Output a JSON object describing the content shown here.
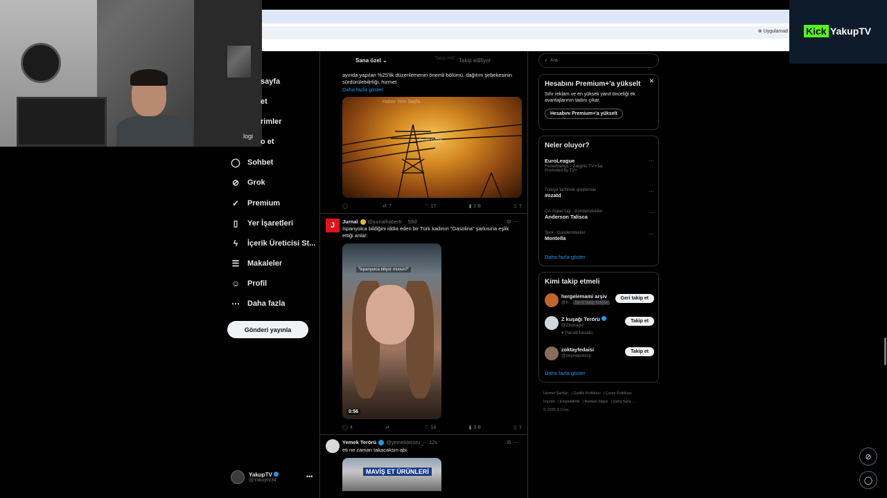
{
  "brand": {
    "kick": "Kick",
    "name": "YakupTV"
  },
  "browser": {
    "apps_label": "Uygulamad"
  },
  "webcam_overlay": {
    "word": "logi"
  },
  "nav": {
    "items": [
      {
        "label": "sayfa",
        "icon": "home-icon"
      },
      {
        "label": "et",
        "icon": "explore-icon"
      },
      {
        "label": "rimler",
        "icon": "notifications-icon"
      },
      {
        "label": "o et",
        "icon": "follow-icon"
      },
      {
        "label": "Sohbet",
        "icon": "chat-icon"
      },
      {
        "label": "Grok",
        "icon": "grok-icon"
      },
      {
        "label": "Premium",
        "icon": "premium-icon"
      },
      {
        "label": "Yer İşaretleri",
        "icon": "bookmark-icon"
      },
      {
        "label": "İçerik Üreticisi St...",
        "icon": "lightning-icon"
      },
      {
        "label": "Makaleler",
        "icon": "articles-icon"
      },
      {
        "label": "Profil",
        "icon": "profile-icon"
      },
      {
        "label": "Daha fazla",
        "icon": "more-icon"
      }
    ],
    "post_button": "Gönderi yayınla",
    "profile": {
      "name": "YakupTV",
      "handle": "@Yakuptv34"
    }
  },
  "tabs": {
    "active": "Sana özel",
    "ghost": "Takip edil",
    "other": "Takip ediliyor"
  },
  "tweet1": {
    "text_l1": "ayında yapılan %25'lik düzenlemenin önemli bölümü, dağıtım şebekesinin",
    "text_l2": "sürdürülebilirliği, hizmet",
    "more": "Daha fazla göster",
    "ghost_l1": "Haber Yeni Sayfa",
    "ghost_l2": "Profil Özeti",
    "actions": {
      "replies": "",
      "retweets": "7",
      "likes": "17",
      "views": "2 B"
    }
  },
  "tweet2": {
    "name": "Jurnal",
    "handle": "@jurnalhabertr",
    "time": "59d",
    "text_l1": "İspanyolca bildiğini iddia eden bir Türk kadının \"Gasolina\" şarkısına eşlik",
    "text_l2": "ettiği anlar:",
    "duration": "0:56",
    "caption": "\"İspanyolca biliyor musun?\"",
    "actions": {
      "replies": "4",
      "retweets": "",
      "likes": "14",
      "views": "3 B"
    }
  },
  "tweet3": {
    "name": "Yemek Terörü",
    "handle": "@yemekteroru_",
    "time": "12s",
    "text": "eti ne zaman takacaksın abi",
    "sign": "MAVİŞ ET ÜRÜNLERİ"
  },
  "search": {
    "placeholder": "Ara"
  },
  "premium": {
    "title": "Hesabını Premium+'a yükselt",
    "text": "Sıfır reklam ve en yüksek yanıt önceliği ek avantajlarının tadını çıkar.",
    "button": "Hesabını Premium+'a yükselt"
  },
  "trends": {
    "title": "Neler oluyor?",
    "items": [
      {
        "category": "",
        "title": "EuroLeague",
        "sub": "Fenerbahçe - Zalgiris TV+'tal",
        "extra": "Promoted by TV+"
      },
      {
        "category": "Türkiye tarihinde gündemde",
        "title": "#ozatd",
        "sub": "",
        "extra": ""
      },
      {
        "category": "Çin Süper Ligi · Gündemdekiler",
        "title": "Anderson Talisca",
        "sub": "",
        "extra": ""
      },
      {
        "category": "Spor · Gündemdekiler",
        "title": "Montella",
        "sub": "",
        "extra": ""
      }
    ],
    "more": "Daha fazla göster"
  },
  "who_to_follow": {
    "title": "Kimi takip etmeli",
    "items": [
      {
        "name": "hergelemami arşiv",
        "handle": "@h...",
        "sub": "Seni takip ediyor",
        "button": "Geri takip et"
      },
      {
        "name": "Z kuşağı Terörü",
        "handle": "@Zkusagiz",
        "sub": "Parodi hesabı",
        "button": "Takip et"
      },
      {
        "name": "zoktayfedaisi",
        "handle": "@zeynepoktsy",
        "sub": "",
        "button": "Takip et"
      }
    ],
    "more": "Daha fazla göster"
  },
  "footer": {
    "links": [
      "Hizmet Şartları",
      "Gizlilik Politikası",
      "Çerez Politikası",
      "Imprint",
      "Erişilebilirlik",
      "Reklam bilgisi",
      "Daha fazla ..."
    ],
    "copyright": "© 2026 X Corp."
  },
  "colors": {
    "accent": "#1d9bf0",
    "background": "#000000",
    "border": "#2f3336",
    "kick_green": "#53fc18"
  }
}
